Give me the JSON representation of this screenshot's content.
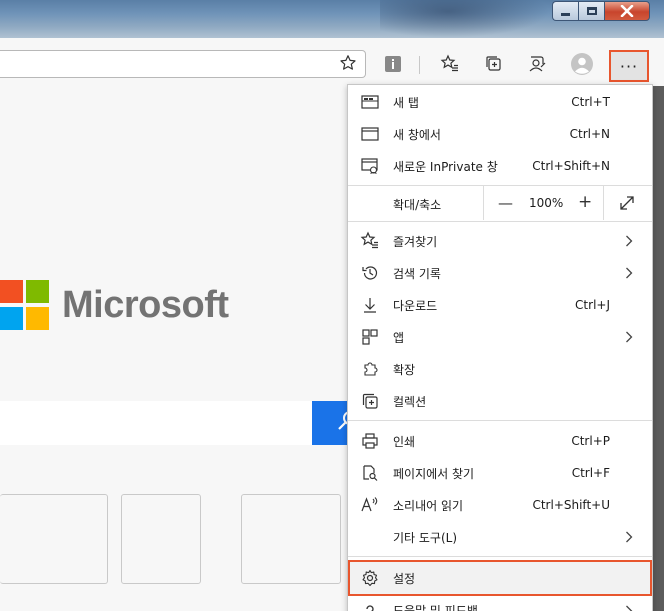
{
  "toolbar": {
    "more_label": "···"
  },
  "menu": {
    "items": [
      {
        "label": "새 탭",
        "shortcut": "Ctrl+T",
        "icon": "new-tab-icon"
      },
      {
        "label": "새 창에서",
        "shortcut": "Ctrl+N",
        "icon": "new-window-icon"
      },
      {
        "label": "새로운 InPrivate 창",
        "shortcut": "Ctrl+Shift+N",
        "icon": "inprivate-icon"
      },
      {
        "label": "즐겨찾기",
        "icon": "favorites-icon"
      },
      {
        "label": "검색 기록",
        "icon": "history-icon"
      },
      {
        "label": "다운로드",
        "shortcut": "Ctrl+J",
        "icon": "download-icon"
      },
      {
        "label": "앱",
        "icon": "apps-icon"
      },
      {
        "label": "확장",
        "icon": "extensions-icon"
      },
      {
        "label": "컬렉션",
        "icon": "collections-icon"
      },
      {
        "label": "인쇄",
        "shortcut": "Ctrl+P",
        "icon": "print-icon"
      },
      {
        "label": "페이지에서 찾기",
        "shortcut": "Ctrl+F",
        "icon": "find-icon"
      },
      {
        "label": "소리내어 읽기",
        "shortcut": "Ctrl+Shift+U",
        "icon": "read-aloud-icon"
      },
      {
        "label": "기타 도구(L)",
        "icon": "more-tools-icon"
      },
      {
        "label": "설정",
        "icon": "settings-icon"
      },
      {
        "label": "도움말 및 피드백",
        "icon": "help-icon"
      }
    ],
    "zoom": {
      "label": "확대/축소",
      "minus": "—",
      "value": "100%",
      "plus": "+"
    }
  },
  "page": {
    "brand": "Microsoft"
  },
  "colors": {
    "accent_highlight": "#e8562e",
    "search_button": "#1a73e8",
    "ms_red": "#f25022",
    "ms_green": "#7fba00",
    "ms_blue": "#00a4ef",
    "ms_yellow": "#ffb900"
  }
}
